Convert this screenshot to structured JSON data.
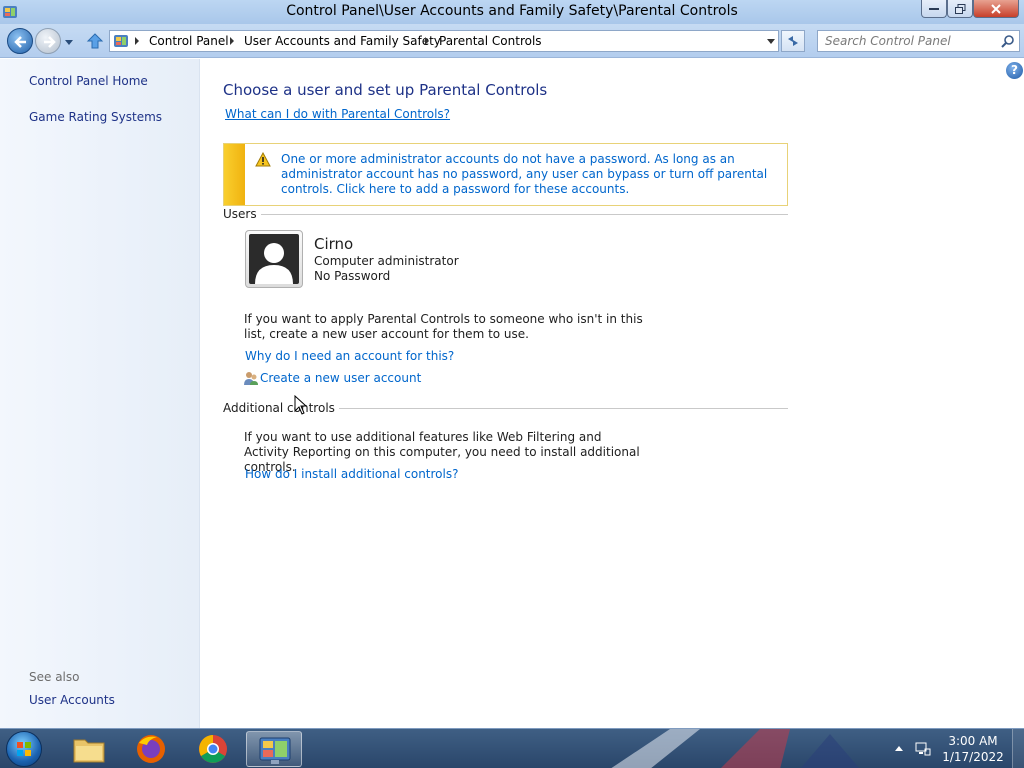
{
  "window": {
    "title": "Control Panel\\User Accounts and Family Safety\\Parental Controls"
  },
  "address_bar": {
    "crumbs": [
      "Control Panel",
      "User Accounts and Family Safety",
      "Parental Controls"
    ]
  },
  "search": {
    "placeholder": "Search Control Panel"
  },
  "sidebar": {
    "home_link": "Control Panel Home",
    "game_rating_link": "Game Rating Systems",
    "see_also_label": "See also",
    "user_accounts_link": "User Accounts"
  },
  "help": {
    "label": "?"
  },
  "main": {
    "title": "Choose a user and set up Parental Controls",
    "what_link": "What can I do with Parental Controls?",
    "warning": "One or more administrator accounts do not have a password. As long as an administrator account has no password, any user can bypass or turn off parental controls. Click here to add a password for these accounts.",
    "users_section_label": "Users",
    "user": {
      "name": "Cirno",
      "role": "Computer administrator",
      "password_status": "No Password"
    },
    "apply_text": "If you want to apply Parental Controls to someone who isn't in this list, create a new user account for them to use.",
    "why_link": "Why do I need an account for this?",
    "create_link": "Create a new user account",
    "additional_section_label": "Additional controls",
    "additional_text": "If you want to use additional features like Web Filtering and Activity Reporting on this computer, you need to install additional controls.",
    "install_link": "How do I install additional controls?"
  },
  "taskbar": {
    "pinned": [
      "windows-explorer",
      "firefox",
      "chrome",
      "control-panel"
    ],
    "clock_time": "3:00 AM",
    "clock_date": "1/17/2022"
  },
  "colors": {
    "link": "#0066cc",
    "heading": "#1e3287",
    "warning_bar": "#f9cf2e"
  }
}
